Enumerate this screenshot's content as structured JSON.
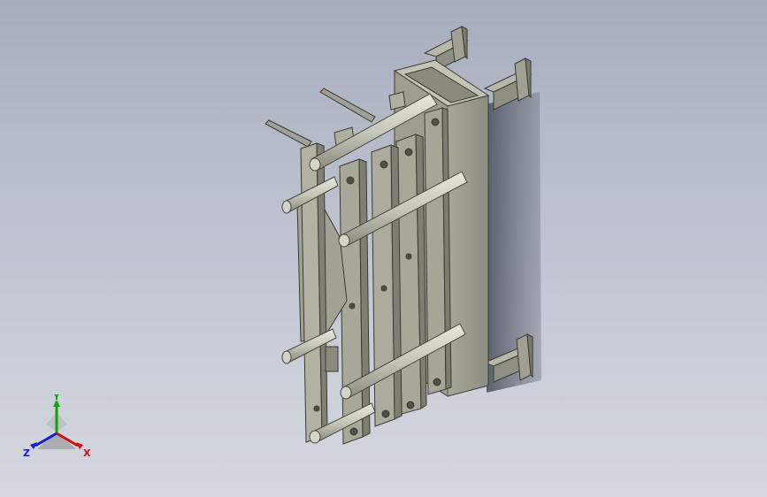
{
  "viewport": {
    "background_top": "#a6adbd",
    "background_bottom": "#d5d8df"
  },
  "model": {
    "icon": "cad-assembly-icon",
    "steel_light": "#b4b4a6",
    "steel_mid": "#9a9a8c",
    "steel_dark": "#6e6e62",
    "rod_color": "#c9c9bd",
    "shadow_color": "#5a606c"
  },
  "triad": {
    "icon": "coordinate-triad-icon",
    "x_label": "X",
    "y_label": "Y",
    "z_label": "Z",
    "x_color": "#d01010",
    "y_color": "#10a010",
    "z_color": "#1020d0"
  }
}
